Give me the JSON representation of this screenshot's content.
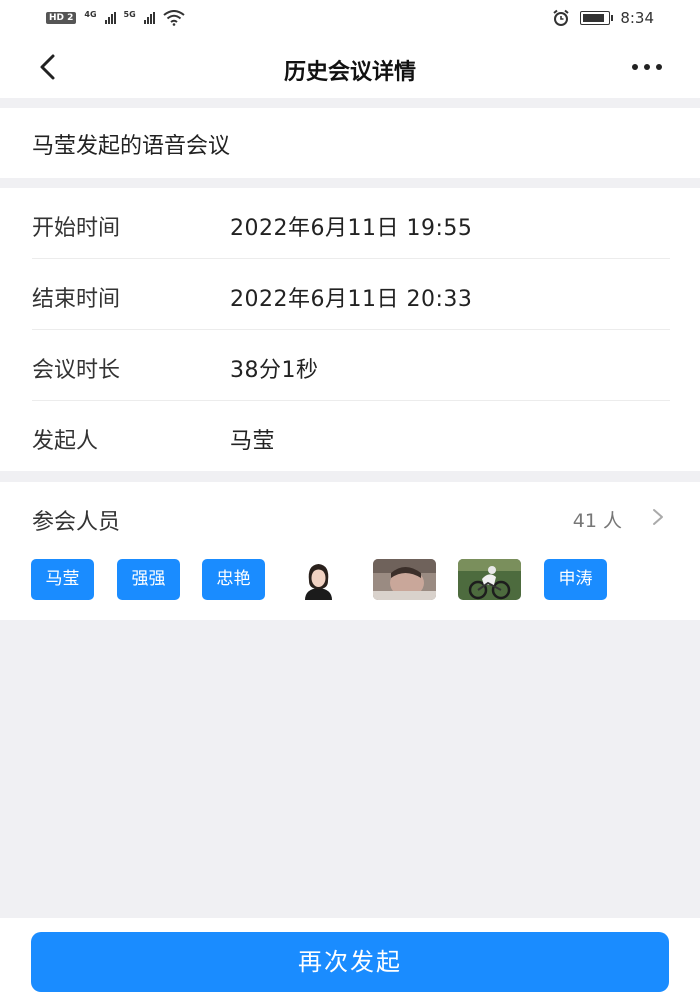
{
  "status_bar": {
    "hd_label": "HD 2",
    "net1_label": "4G",
    "net2_label": "5G",
    "time": "8:34",
    "battery_level": 0.85
  },
  "nav": {
    "title": "历史会议详情"
  },
  "meeting": {
    "name": "马莹发起的语音会议"
  },
  "details": [
    {
      "label": "开始时间",
      "value": "2022年6月11日 19:55"
    },
    {
      "label": "结束时间",
      "value": "2022年6月11日 20:33"
    },
    {
      "label": "会议时长",
      "value": "38分1秒"
    },
    {
      "label": "发起人",
      "value": "马莹"
    }
  ],
  "participants": {
    "title": "参会人员",
    "count": "41 人",
    "avatars": [
      {
        "type": "text",
        "label": "马莹"
      },
      {
        "type": "text",
        "label": "强强"
      },
      {
        "type": "text",
        "label": "忠艳"
      },
      {
        "type": "photo",
        "icon": "person-photo-icon"
      },
      {
        "type": "photo",
        "icon": "person-photo-icon"
      },
      {
        "type": "photo",
        "icon": "cyclist-photo-icon"
      },
      {
        "type": "text",
        "label": "申涛"
      }
    ]
  },
  "actions": {
    "relaunch_label": "再次发起"
  },
  "colors": {
    "accent": "#1a8cff",
    "background": "#f0f0f3"
  }
}
